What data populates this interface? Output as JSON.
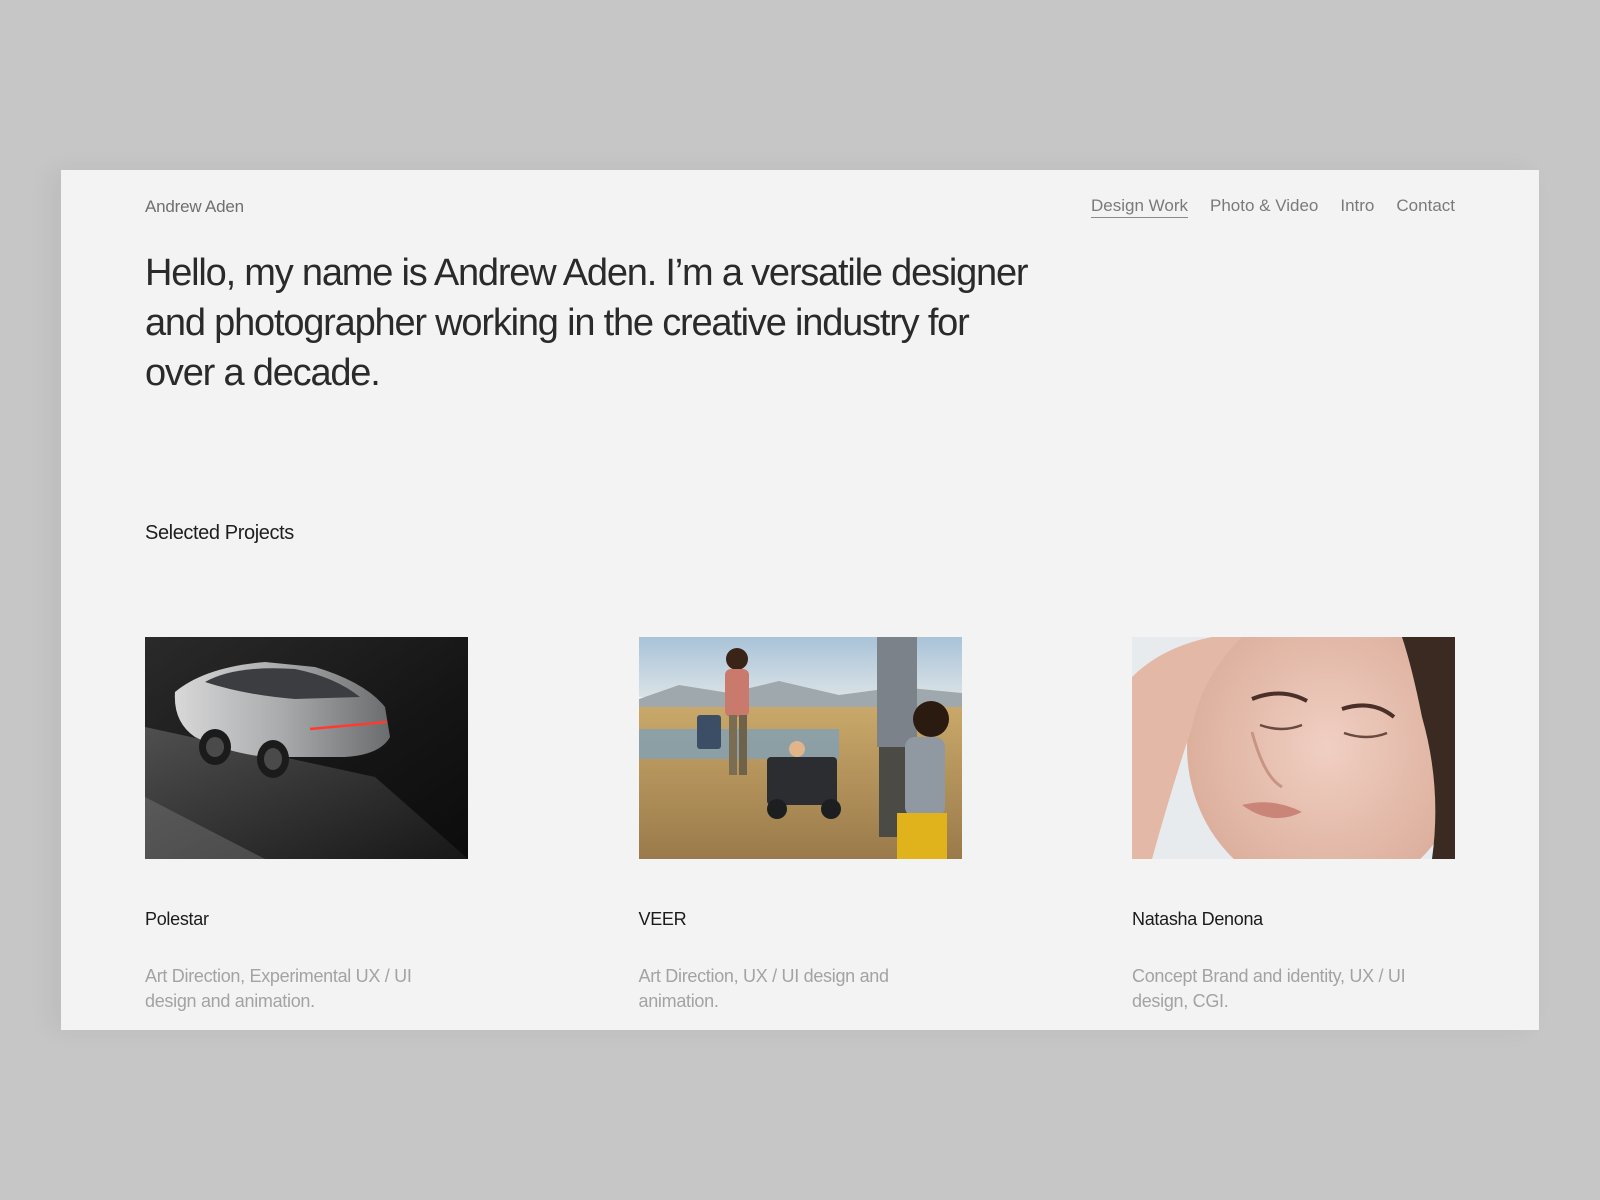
{
  "header": {
    "brand": "Andrew Aden",
    "nav": [
      {
        "label": "Design Work",
        "active": true
      },
      {
        "label": "Photo & Video",
        "active": false
      },
      {
        "label": "Intro",
        "active": false
      },
      {
        "label": "Contact",
        "active": false
      }
    ]
  },
  "hero": {
    "text": "Hello, my name is Andrew Aden. I’m a versatile designer and photographer working in the creative industry for over a decade."
  },
  "projects": {
    "title": "Selected Projects",
    "items": [
      {
        "name": "Polestar",
        "description": "Art Direction, Experimental UX / UI design and animation.",
        "image": "car-photo"
      },
      {
        "name": "VEER",
        "description": "Art Direction, UX / UI design and animation.",
        "image": "family-outdoor-photo"
      },
      {
        "name": "Natasha Denona",
        "description": "Concept Brand and identity, UX / UI design, CGI.",
        "image": "portrait-photo"
      }
    ]
  },
  "colors": {
    "background": "#c6c6c6",
    "page": "#f3f3f3",
    "text_primary": "#2a2a2a",
    "text_muted": "#a3a3a3"
  }
}
